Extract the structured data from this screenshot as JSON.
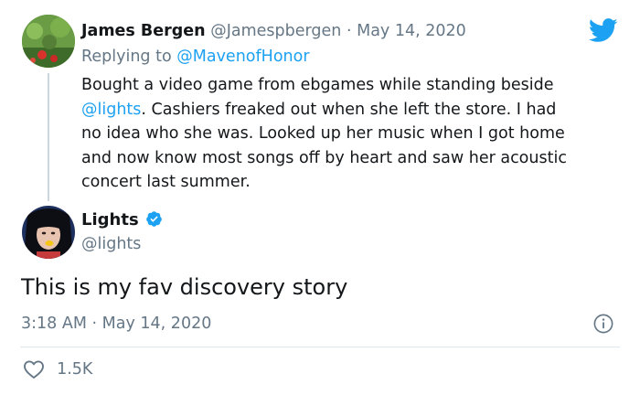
{
  "reply_tweet": {
    "author_name": "James Bergen",
    "author_handle": "@Jamespbergen",
    "separator": "·",
    "date": "May 14, 2020",
    "replying_to_label": "Replying to",
    "replying_to_handle": "@MavenofHonor",
    "body_line1": "Bought a video game from ebgames while standing beside",
    "body_mention": "@lights",
    "body_line2_rest": ".  Cashiers freaked out when she left the store. I had",
    "body_line3": "no idea who she was.  Looked up her music when I got home",
    "body_line4": "and now know most songs off by heart and saw her acoustic",
    "body_line5": "concert last summer."
  },
  "main_tweet": {
    "author_name": "Lights",
    "author_handle": "@lights",
    "verified": true,
    "text": "This is my fav discovery story",
    "time": "3:18 AM",
    "separator": "·",
    "date": "May 14, 2020",
    "like_count": "1.5K"
  },
  "icons": {
    "brand": "twitter-bird-icon",
    "verified": "verified-badge-icon",
    "info": "info-icon",
    "like": "heart-icon"
  },
  "colors": {
    "brand_blue": "#1da1f2",
    "secondary_text": "#657786",
    "primary_text": "#14171a",
    "thread_line": "#ccd6dd",
    "divider": "#e1e8ed"
  }
}
